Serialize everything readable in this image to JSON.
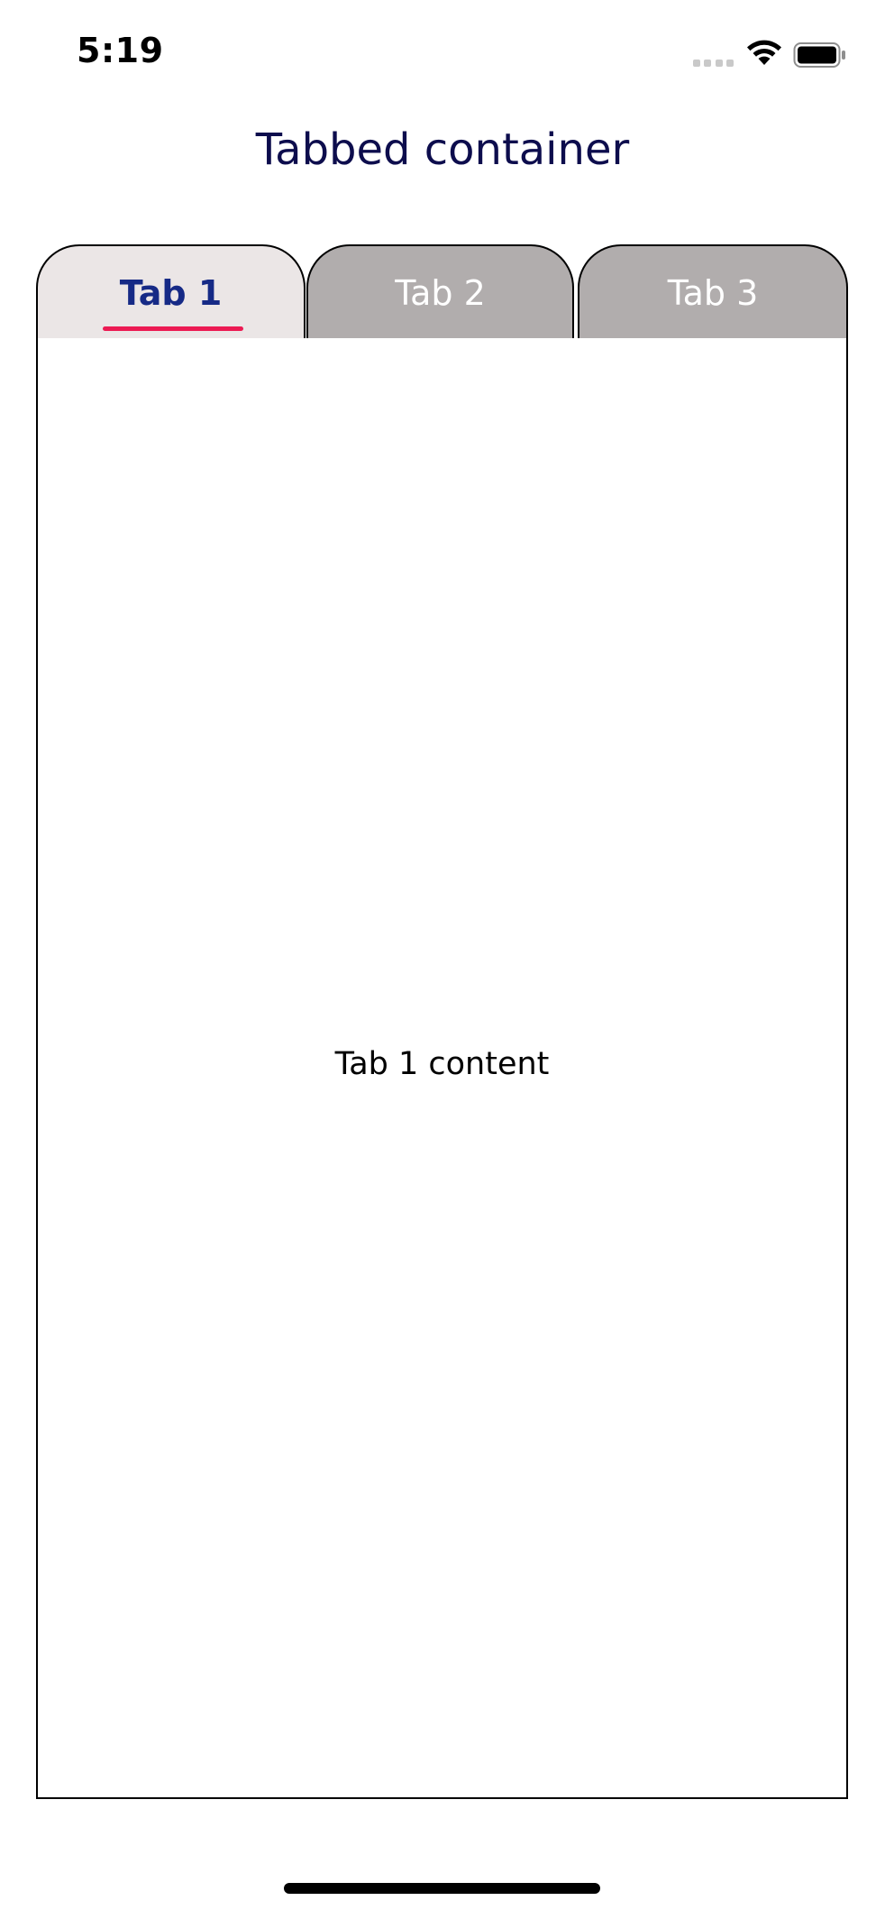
{
  "status_bar": {
    "time": "5:19",
    "icons": [
      "cellular-signal-icon",
      "wifi-icon",
      "battery-icon"
    ]
  },
  "header": {
    "title": "Tabbed container"
  },
  "tabs": [
    {
      "label": "Tab 1",
      "selected": true
    },
    {
      "label": "Tab 2",
      "selected": false
    },
    {
      "label": "Tab 3",
      "selected": false
    }
  ],
  "content": {
    "text": "Tab 1 content"
  },
  "colors": {
    "title_text": "#0d0d4d",
    "active_tab_bg": "#ebe6e6",
    "active_tab_text": "#162a86",
    "inactive_tab_bg": "#b1adad",
    "inactive_tab_text": "#ffffff",
    "active_indicator": "#ec1a53"
  }
}
